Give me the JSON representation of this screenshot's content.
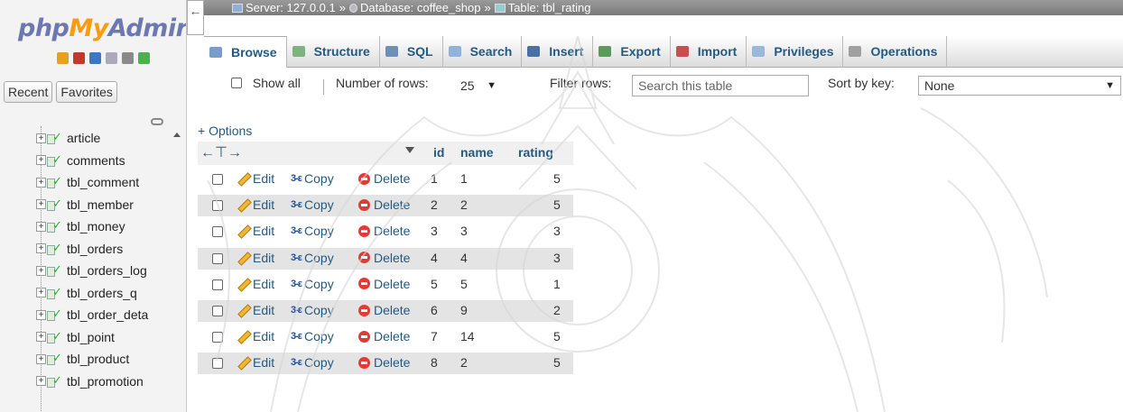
{
  "app": {
    "logo_php": "php",
    "logo_my": "My",
    "logo_admin": "Admir",
    "nav_tabs": [
      "Recent",
      "Favorites"
    ]
  },
  "quick_icons": [
    {
      "name": "home-icon",
      "color": "#e8a020"
    },
    {
      "name": "exit-icon",
      "color": "#c0392b"
    },
    {
      "name": "help-icon",
      "color": "#3a78c4"
    },
    {
      "name": "docs-icon",
      "color": "#aab"
    },
    {
      "name": "settings-icon",
      "color": "#8a8a8a"
    },
    {
      "name": "reload-icon",
      "color": "#4caf50"
    }
  ],
  "tree": [
    {
      "label": "article"
    },
    {
      "label": "comments"
    },
    {
      "label": "tbl_comment"
    },
    {
      "label": "tbl_member"
    },
    {
      "label": "tbl_money"
    },
    {
      "label": "tbl_orders"
    },
    {
      "label": "tbl_orders_log"
    },
    {
      "label": "tbl_orders_q"
    },
    {
      "label": "tbl_order_deta"
    },
    {
      "label": "tbl_point"
    },
    {
      "label": "tbl_product"
    },
    {
      "label": "tbl_promotion"
    }
  ],
  "breadcrumb": {
    "server": "Server: 127.0.0.1",
    "database": "Database: coffee_shop",
    "table": "Table: tbl_rating",
    "separator": "»"
  },
  "menu": [
    {
      "label": "Browse",
      "icon": "browse-icon",
      "color": "#7a9cc9"
    },
    {
      "label": "Structure",
      "icon": "structure-icon",
      "color": "#7fb27f"
    },
    {
      "label": "SQL",
      "icon": "sql-icon",
      "color": "#6e8fb8"
    },
    {
      "label": "Search",
      "icon": "search-icon",
      "color": "#8fb3dd"
    },
    {
      "label": "Insert",
      "icon": "insert-icon",
      "color": "#4a6fa5"
    },
    {
      "label": "Export",
      "icon": "export-icon",
      "color": "#5a9a5a"
    },
    {
      "label": "Import",
      "icon": "import-icon",
      "color": "#c65050"
    },
    {
      "label": "Privileges",
      "icon": "privileges-icon",
      "color": "#9bb7da"
    },
    {
      "label": "Operations",
      "icon": "operations-icon",
      "color": "#a0a0a0"
    }
  ],
  "toolbar": {
    "show_all": "Show all",
    "number_of_rows": "Number of rows:",
    "rows_value": "25",
    "filter_rows": "Filter rows:",
    "search_placeholder": "Search this table",
    "sort_by_key": "Sort by key:",
    "sort_value": "None"
  },
  "options_link": "+ Options",
  "table": {
    "columns": [
      "id",
      "name",
      "rating"
    ],
    "actions": {
      "edit": "Edit",
      "copy": "Copy",
      "delete": "Delete"
    },
    "rows": [
      {
        "id": "1",
        "name": "1",
        "rating": "5"
      },
      {
        "id": "2",
        "name": "2",
        "rating": "5"
      },
      {
        "id": "3",
        "name": "3",
        "rating": "3"
      },
      {
        "id": "4",
        "name": "4",
        "rating": "3"
      },
      {
        "id": "5",
        "name": "5",
        "rating": "1"
      },
      {
        "id": "6",
        "name": "9",
        "rating": "2"
      },
      {
        "id": "7",
        "name": "14",
        "rating": "5"
      },
      {
        "id": "8",
        "name": "2",
        "rating": "5"
      }
    ]
  }
}
